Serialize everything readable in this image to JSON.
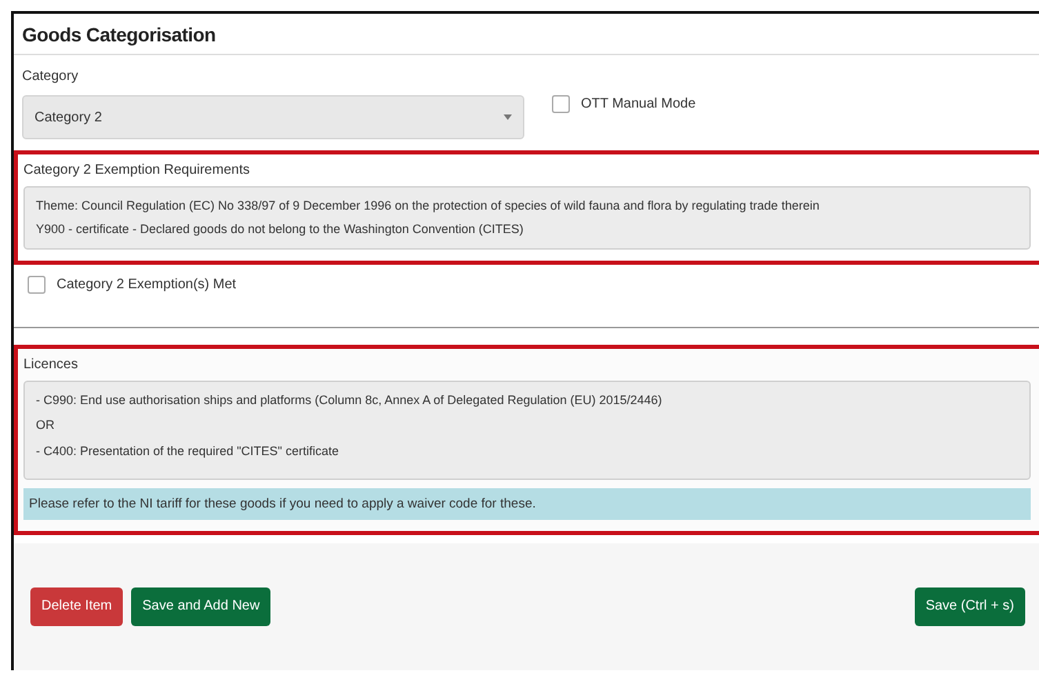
{
  "title": "Goods Categorisation",
  "category": {
    "label": "Category",
    "value": "Category 2"
  },
  "ott_manual_mode": {
    "label": "OTT Manual Mode",
    "checked": false
  },
  "exemption_requirements": {
    "heading": "Category 2 Exemption Requirements",
    "lines": [
      "Theme: Council Regulation (EC) No 338/97 of 9 December 1996 on the protection of species of wild fauna and flora by regulating trade therein",
      "Y900 - certificate - Declared goods do not belong to the Washington Convention (CITES)"
    ]
  },
  "exemptions_met": {
    "label": "Category 2 Exemption(s) Met",
    "checked": false
  },
  "licences": {
    "heading": "Licences",
    "lines": [
      "- C990: End use authorisation ships and platforms (Column 8c, Annex A of Delegated Regulation (EU) 2015/2446)",
      "OR",
      "- C400: Presentation of the required \"CITES\" certificate"
    ],
    "note": "Please refer to the NI tariff for these goods if you need to apply a waiver code for these."
  },
  "buttons": [
    {
      "label": "Delete Item",
      "kind": "danger"
    },
    {
      "label": "Save and Add New",
      "kind": "primary"
    },
    {
      "label": "Save (Ctrl + s)",
      "kind": "primary"
    }
  ]
}
